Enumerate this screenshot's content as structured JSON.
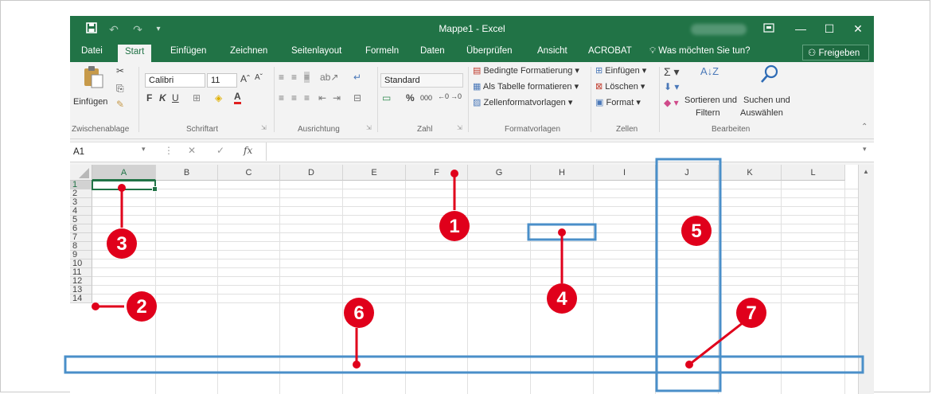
{
  "window": {
    "title": "Mappe1 - Excel",
    "qat": [
      "save-icon",
      "undo-icon",
      "redo-icon",
      "customize-icon"
    ],
    "controls": [
      "ribbon-display-icon",
      "minimize-icon",
      "maximize-icon",
      "close-icon"
    ]
  },
  "tabs": [
    "Datei",
    "Start",
    "Einfügen",
    "Zeichnen",
    "Seitenlayout",
    "Formeln",
    "Daten",
    "Überprüfen",
    "Ansicht",
    "ACROBAT"
  ],
  "active_tab": "Start",
  "tell_me": "Was möchten Sie tun?",
  "share": "Freigeben",
  "ribbon": {
    "clipboard": {
      "label": "Zwischenablage",
      "paste": "Einfügen"
    },
    "font": {
      "label": "Schriftart",
      "family": "Calibri",
      "size": "11",
      "bold": "F",
      "italic": "K",
      "underline": "U"
    },
    "alignment": {
      "label": "Ausrichtung"
    },
    "number": {
      "label": "Zahl",
      "format": "Standard",
      "percent": "%",
      "thousands": "000"
    },
    "styles": {
      "label": "Formatvorlagen",
      "conditional": "Bedingte Formatierung",
      "as_table": "Als Tabelle formatieren",
      "cell_styles": "Zellenformatvorlagen"
    },
    "cells": {
      "label": "Zellen",
      "insert": "Einfügen",
      "delete": "Löschen",
      "format": "Format"
    },
    "editing": {
      "label": "Bearbeiten",
      "sort_line1": "Sortieren und",
      "sort_line2": "Filtern",
      "find_line1": "Suchen und",
      "find_line2": "Auswählen"
    }
  },
  "formula_bar": {
    "name_box": "A1",
    "fx": "fx",
    "content": ""
  },
  "grid": {
    "columns": [
      "A",
      "B",
      "C",
      "D",
      "E",
      "F",
      "G",
      "H",
      "I",
      "J",
      "K",
      "L"
    ],
    "rows": [
      "1",
      "2",
      "3",
      "4",
      "5",
      "6",
      "7",
      "8",
      "9",
      "10",
      "11",
      "12",
      "13",
      "14"
    ],
    "active_cell": "A1"
  },
  "annotations": {
    "color_red": "#e0001b",
    "color_blue": "#4a8fc9",
    "markers": [
      "1",
      "2",
      "3",
      "4",
      "5",
      "6",
      "7"
    ]
  }
}
